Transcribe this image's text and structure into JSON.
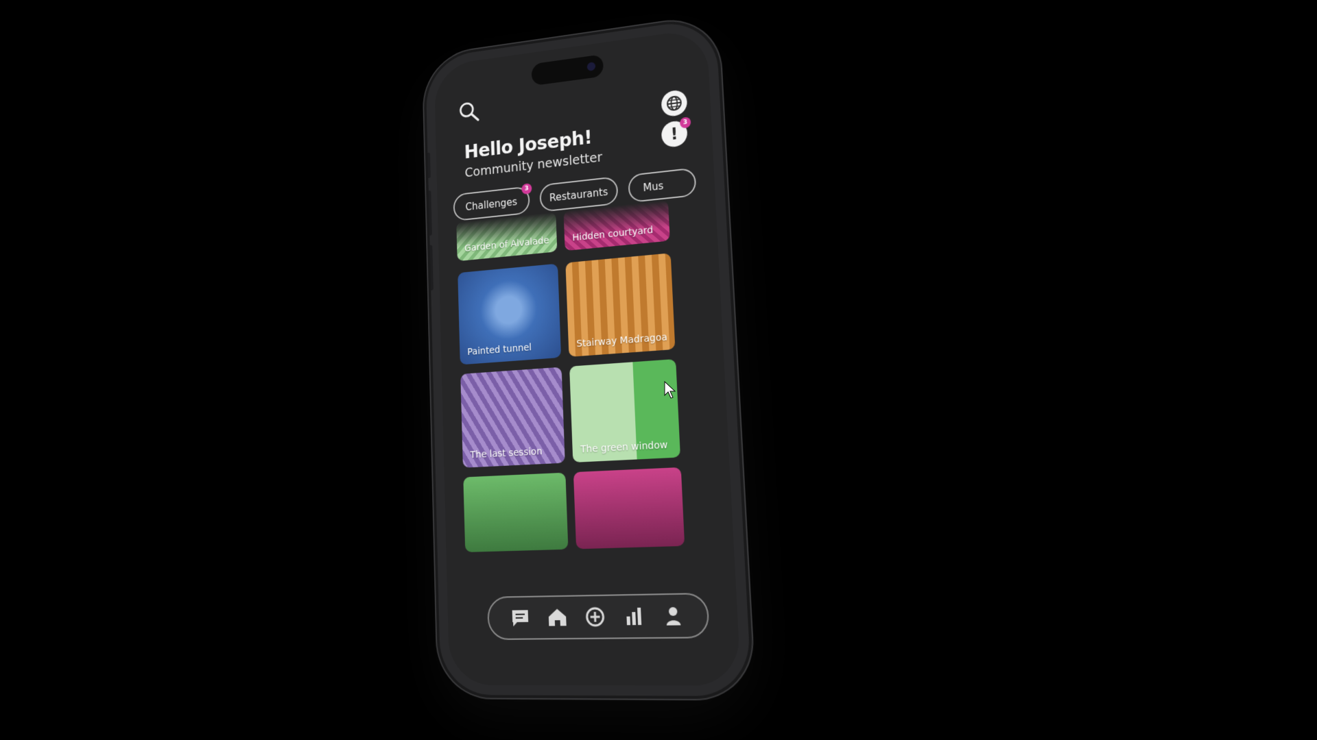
{
  "header": {
    "greeting": "Hello Joseph!",
    "subtitle": "Community newsletter",
    "alert_badge": "3"
  },
  "icons": {
    "search": "search-icon",
    "globe": "globe-icon",
    "alert": "alert-icon"
  },
  "chips": [
    {
      "label": "Challenges",
      "badge": "3"
    },
    {
      "label": "Restaurants"
    },
    {
      "label": "Mus"
    }
  ],
  "cards": [
    {
      "label": "Garden of Alvalade",
      "color": "#8fc78a"
    },
    {
      "label": "Hidden courtyard",
      "color": "#c0337f"
    },
    {
      "label": "Painted tunnel",
      "color": "#3f6fb8"
    },
    {
      "label": "Stairway Madragoa",
      "color": "#cf8a3a"
    },
    {
      "label": "The last session",
      "color": "#8f72b8"
    },
    {
      "label": "The green window",
      "color": "#7fc27a"
    },
    {
      "label": "",
      "color": "#5aa85c"
    },
    {
      "label": "",
      "color": "#b13a78"
    }
  ],
  "tabbar": [
    {
      "icon": "chat-icon"
    },
    {
      "icon": "home-icon"
    },
    {
      "icon": "add-icon"
    },
    {
      "icon": "stats-icon"
    },
    {
      "icon": "profile-icon"
    }
  ],
  "colors": {
    "background": "#000000",
    "screen": "#262627",
    "accent_badge": "#d23a9a"
  }
}
